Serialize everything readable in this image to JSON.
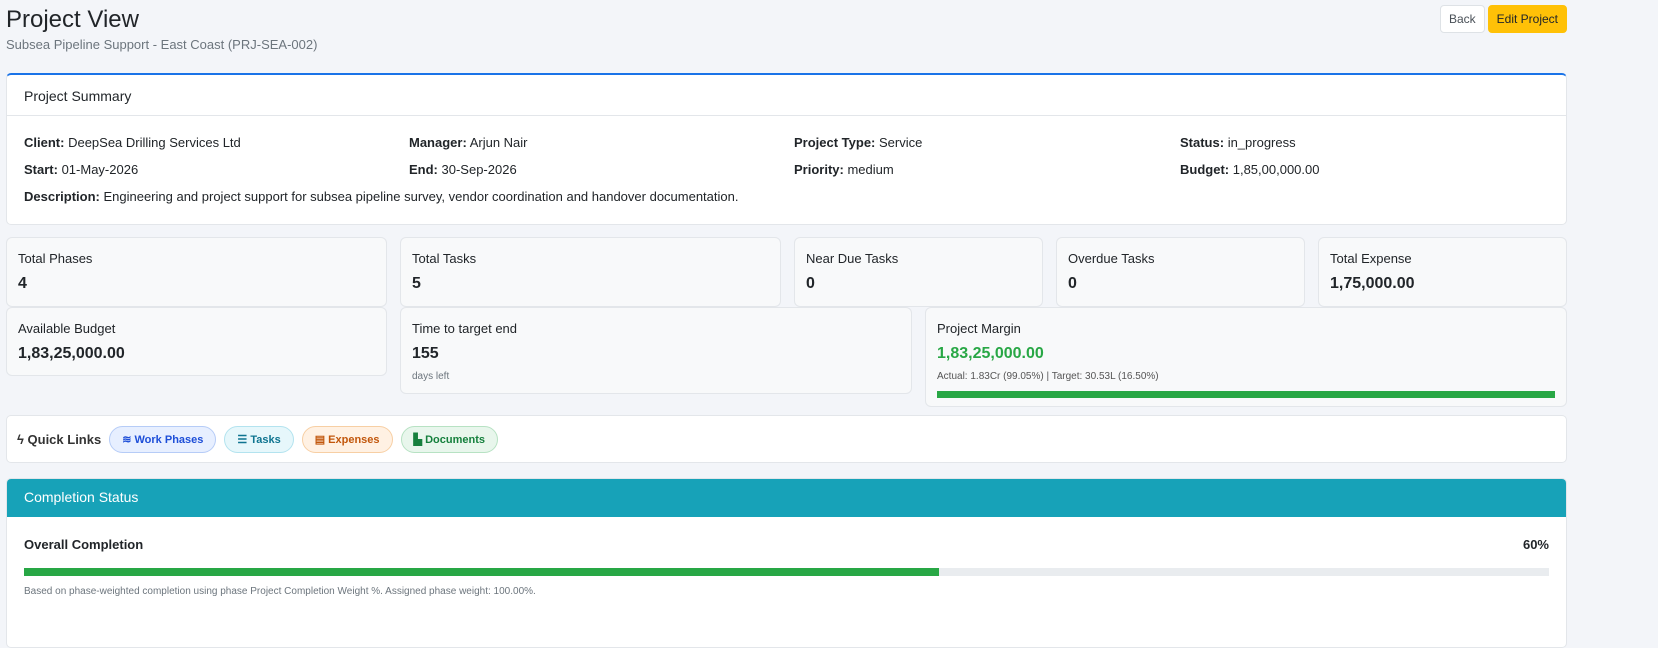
{
  "header": {
    "title": "Project View",
    "subtitle": "Subsea Pipeline Support - East Coast (PRJ-SEA-002)",
    "back": "Back",
    "edit": "Edit Project"
  },
  "summary": {
    "title": "Project Summary",
    "fields": [
      {
        "label": "Client:",
        "value": "DeepSea Drilling Services Ltd"
      },
      {
        "label": "Manager:",
        "value": "Arjun Nair"
      },
      {
        "label": "Project Type:",
        "value": "Service"
      },
      {
        "label": "Status:",
        "value": "in_progress"
      },
      {
        "label": "Start:",
        "value": "01-May-2026"
      },
      {
        "label": "End:",
        "value": "30-Sep-2026"
      },
      {
        "label": "Priority:",
        "value": "medium"
      },
      {
        "label": "Budget:",
        "value": "1,85,00,000.00"
      },
      {
        "label": "Description:",
        "value": "Engineering and project support for subsea pipeline survey, vendor coordination and handover documentation."
      }
    ]
  },
  "stats": {
    "total_phases": {
      "label": "Total Phases",
      "value": "4"
    },
    "total_tasks": {
      "label": "Total Tasks",
      "value": "5"
    },
    "near_due": {
      "label": "Near Due Tasks",
      "value": "0"
    },
    "overdue": {
      "label": "Overdue Tasks",
      "value": "0"
    },
    "total_expense": {
      "label": "Total Expense",
      "value": "1,75,000.00"
    },
    "available_budget": {
      "label": "Available Budget",
      "value": "1,83,25,000.00"
    },
    "time_to_end": {
      "label": "Time to target end",
      "value": "155",
      "sub": "days left"
    },
    "margin": {
      "label": "Project Margin",
      "value": "1,83,25,000.00",
      "sub": "Actual: 1.83Cr (99.05%) | Target: 30.53L (16.50%)",
      "progress_pct": 100
    }
  },
  "quick_links": {
    "title": "Quick Links",
    "items": [
      "Work Phases",
      "Tasks",
      "Expenses",
      "Documents"
    ]
  },
  "completion": {
    "title": "Completion Status",
    "label": "Overall Completion",
    "percent": "60%",
    "progress_pct": 60,
    "note": "Based on phase-weighted completion using phase Project Completion Weight %. Assigned phase weight: 100.00%."
  }
}
